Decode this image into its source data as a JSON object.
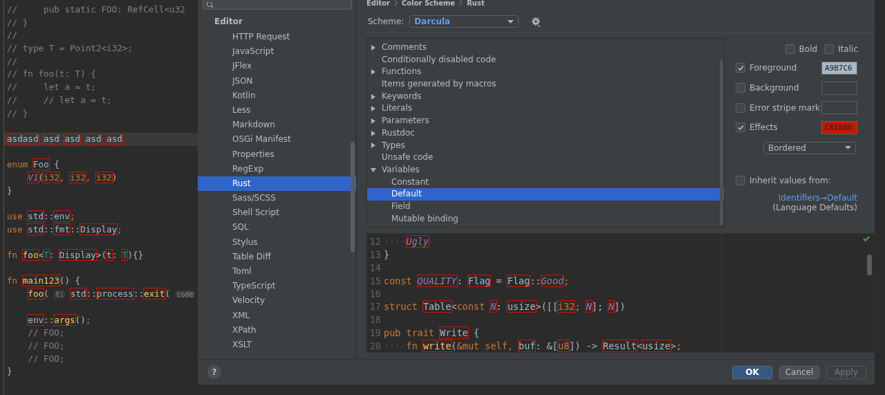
{
  "editor": {
    "lines": [
      {
        "current": false,
        "tokens": [
          {
            "kind": "comment",
            "text": "//     pub static FOO: RefCell<u32"
          }
        ]
      },
      {
        "current": false,
        "tokens": [
          {
            "kind": "comment",
            "text": "// }"
          }
        ]
      },
      {
        "current": false,
        "tokens": [
          {
            "kind": "comment",
            "text": "//"
          }
        ]
      },
      {
        "current": false,
        "tokens": [
          {
            "kind": "comment",
            "text": "// type T = Point2<i32>;"
          }
        ]
      },
      {
        "current": false,
        "tokens": [
          {
            "kind": "comment",
            "text": "//"
          }
        ]
      },
      {
        "current": false,
        "tokens": [
          {
            "kind": "comment",
            "text": "// fn foo(t: T) {"
          }
        ]
      },
      {
        "current": false,
        "tokens": [
          {
            "kind": "comment",
            "text": "//     let a = t;"
          }
        ]
      },
      {
        "current": false,
        "tokens": [
          {
            "kind": "comment",
            "text": "//     // let a = t;"
          }
        ]
      },
      {
        "current": false,
        "tokens": [
          {
            "kind": "comment",
            "text": "// }"
          }
        ]
      },
      {
        "current": false
      },
      {
        "current": true,
        "tokens": [
          {
            "kind": "ident",
            "text": "asdasd"
          },
          {
            "kind": "ident",
            "text": "asd",
            "space_before": true
          },
          {
            "kind": "ident",
            "text": "asd",
            "space_before": true
          },
          {
            "kind": "ident",
            "text": "asd",
            "space_before": true
          },
          {
            "kind": "ident",
            "text": "asd",
            "space_before": true
          }
        ]
      },
      {
        "current": false
      },
      {
        "current": false,
        "tokens": [
          {
            "kind": "kw",
            "text": "enum "
          },
          {
            "kind": "ident",
            "text": "Foo"
          },
          {
            "kind": "plain",
            "text": " {"
          }
        ]
      },
      {
        "current": false,
        "tokens": [
          {
            "kind": "const",
            "text": "V1",
            "indent": true
          },
          {
            "kind": "plain",
            "text": "("
          },
          {
            "kind": "builtin",
            "text": "i32"
          },
          {
            "kind": "kw",
            "text": ", "
          },
          {
            "kind": "builtin",
            "text": "i32"
          },
          {
            "kind": "kw",
            "text": ", "
          },
          {
            "kind": "builtin",
            "text": "i32"
          },
          {
            "kind": "plain",
            "text": ")"
          }
        ]
      },
      {
        "current": false,
        "tokens": [
          {
            "kind": "plain",
            "text": "}"
          }
        ]
      },
      {
        "current": false
      },
      {
        "current": false,
        "tokens": [
          {
            "kind": "kw",
            "text": "use "
          },
          {
            "kind": "ident",
            "text": "std"
          },
          {
            "kind": "plain",
            "text": "::"
          },
          {
            "kind": "ident",
            "text": "env"
          },
          {
            "kind": "kw",
            "text": ";"
          }
        ]
      },
      {
        "current": false,
        "tokens": [
          {
            "kind": "kw",
            "text": "use "
          },
          {
            "kind": "ident",
            "text": "std"
          },
          {
            "kind": "plain",
            "text": "::"
          },
          {
            "kind": "ident",
            "text": "fmt"
          },
          {
            "kind": "plain",
            "text": "::"
          },
          {
            "kind": "ident",
            "text": "Display"
          },
          {
            "kind": "kw",
            "text": ";"
          }
        ]
      },
      {
        "current": false
      },
      {
        "current": false,
        "tokens": [
          {
            "kind": "kw",
            "text": "fn "
          },
          {
            "kind": "fn",
            "text": "foo"
          },
          {
            "kind": "plain",
            "text": "<"
          },
          {
            "kind": "tparam",
            "text": "T"
          },
          {
            "kind": "plain",
            "text": ": "
          },
          {
            "kind": "ident",
            "text": "Display"
          },
          {
            "kind": "plain",
            "text": ">("
          },
          {
            "kind": "param",
            "text": "t"
          },
          {
            "kind": "plain",
            "text": ": "
          },
          {
            "kind": "tparam",
            "text": "T"
          },
          {
            "kind": "plain",
            "text": "){}"
          }
        ]
      },
      {
        "current": false
      },
      {
        "current": false,
        "tokens": [
          {
            "kind": "kw",
            "text": "fn "
          },
          {
            "kind": "fn",
            "text": "main123"
          },
          {
            "kind": "plain",
            "text": "() {"
          }
        ]
      },
      {
        "current": false,
        "tokens": [
          {
            "kind": "fn",
            "text": "foo",
            "indent": true
          },
          {
            "kind": "plain",
            "text": "( "
          },
          {
            "kind": "hint",
            "text": "t:"
          },
          {
            "kind": "ident",
            "text": "std",
            "space_before": true
          },
          {
            "kind": "plain",
            "text": "::"
          },
          {
            "kind": "ident",
            "text": "process"
          },
          {
            "kind": "plain",
            "text": "::"
          },
          {
            "kind": "fn",
            "text": "exit"
          },
          {
            "kind": "plain",
            "text": "( "
          },
          {
            "kind": "hint",
            "text": "code"
          }
        ]
      },
      {
        "current": false
      },
      {
        "current": false,
        "tokens": [
          {
            "kind": "ident",
            "text": "env",
            "indent": true
          },
          {
            "kind": "plain",
            "text": "::"
          },
          {
            "kind": "fn",
            "text": "args"
          },
          {
            "kind": "plain",
            "text": "()"
          },
          {
            "kind": "kw",
            "text": ";"
          }
        ]
      },
      {
        "current": false,
        "tokens": [
          {
            "kind": "comment",
            "text": "    // FOO;"
          }
        ]
      },
      {
        "current": false,
        "tokens": [
          {
            "kind": "comment",
            "text": "    // FOO;"
          }
        ]
      },
      {
        "current": false,
        "tokens": [
          {
            "kind": "comment",
            "text": "    // FOO;"
          }
        ]
      },
      {
        "current": false,
        "tokens": [
          {
            "kind": "plain",
            "text": "}"
          }
        ]
      }
    ]
  },
  "dialog": {
    "sidebar": {
      "section": "Editor",
      "items": [
        {
          "label": "HTTP Request",
          "selected": false
        },
        {
          "label": "JavaScript",
          "selected": false
        },
        {
          "label": "JFlex",
          "selected": false
        },
        {
          "label": "JSON",
          "selected": false
        },
        {
          "label": "Kotlin",
          "selected": false
        },
        {
          "label": "Less",
          "selected": false
        },
        {
          "label": "Markdown",
          "selected": false
        },
        {
          "label": "OSGi Manifest",
          "selected": false
        },
        {
          "label": "Properties",
          "selected": false
        },
        {
          "label": "RegExp",
          "selected": false
        },
        {
          "label": "Rust",
          "selected": true
        },
        {
          "label": "Sass/SCSS",
          "selected": false
        },
        {
          "label": "Shell Script",
          "selected": false
        },
        {
          "label": "SQL",
          "selected": false
        },
        {
          "label": "Stylus",
          "selected": false
        },
        {
          "label": "Table Diff",
          "selected": false
        },
        {
          "label": "Toml",
          "selected": false
        },
        {
          "label": "TypeScript",
          "selected": false
        },
        {
          "label": "Velocity",
          "selected": false
        },
        {
          "label": "XML",
          "selected": false
        },
        {
          "label": "XPath",
          "selected": false
        },
        {
          "label": "XSLT",
          "selected": false
        }
      ]
    },
    "breadcrumb": [
      "Editor",
      "Color Scheme",
      "Rust"
    ],
    "scheme": {
      "label": "Scheme:",
      "value": "Darcula"
    },
    "tree": [
      {
        "label": "Comments",
        "kind": "group",
        "expanded": false,
        "selected": false
      },
      {
        "label": "Conditionally disabled code",
        "kind": "leaf",
        "selected": false
      },
      {
        "label": "Functions",
        "kind": "group",
        "expanded": false,
        "selected": false
      },
      {
        "label": "Items generated by macros",
        "kind": "leaf",
        "selected": false
      },
      {
        "label": "Keywords",
        "kind": "group",
        "expanded": false,
        "selected": false
      },
      {
        "label": "Literals",
        "kind": "group",
        "expanded": false,
        "selected": false
      },
      {
        "label": "Parameters",
        "kind": "group",
        "expanded": false,
        "selected": false
      },
      {
        "label": "Rustdoc",
        "kind": "group",
        "expanded": false,
        "selected": false
      },
      {
        "label": "Types",
        "kind": "group",
        "expanded": false,
        "selected": false
      },
      {
        "label": "Unsafe code",
        "kind": "leaf",
        "selected": false
      },
      {
        "label": "Variables",
        "kind": "group",
        "expanded": true,
        "selected": false,
        "children": [
          {
            "label": "Constant",
            "kind": "leaf",
            "selected": false
          },
          {
            "label": "Default",
            "kind": "leaf",
            "selected": true
          },
          {
            "label": "Field",
            "kind": "leaf",
            "selected": false
          },
          {
            "label": "Mutable binding",
            "kind": "leaf",
            "selected": false
          }
        ]
      }
    ],
    "font_style": [
      {
        "label": "Bold",
        "checked": false
      },
      {
        "label": "Italic",
        "checked": false
      }
    ],
    "attributes": [
      {
        "label": "Foreground",
        "checked": true,
        "value": "A9B7C6",
        "color": "#a9b7c6"
      },
      {
        "label": "Background",
        "checked": false
      },
      {
        "label": "Error stripe mark",
        "checked": false
      },
      {
        "label": "Effects",
        "checked": true,
        "value": "C61800",
        "color": "#c61800"
      }
    ],
    "effect_type": "Bordered",
    "inherit": {
      "label": "Inherit values from:",
      "checked": false,
      "link": "Identifiers→Default",
      "note": "(Language Defaults)"
    },
    "preview": [
      {
        "number": "12",
        "tokens": [
          {
            "kind": "ws",
            "text": "····"
          },
          {
            "kind": "const",
            "text": "Ugly"
          }
        ]
      },
      {
        "number": "13",
        "tokens": [
          {
            "kind": "plain",
            "text": "}"
          }
        ]
      },
      {
        "number": "14"
      },
      {
        "number": "15",
        "tokens": [
          {
            "kind": "kw",
            "text": "const "
          },
          {
            "kind": "const",
            "text": "QUALITY"
          },
          {
            "kind": "plain",
            "text": ": "
          },
          {
            "kind": "ident",
            "text": "Flag"
          },
          {
            "kind": "plain",
            "text": " = "
          },
          {
            "kind": "ident",
            "text": "Flag"
          },
          {
            "kind": "plain",
            "text": "::"
          },
          {
            "kind": "const",
            "text": "Good"
          },
          {
            "kind": "kw",
            "text": ";"
          }
        ]
      },
      {
        "number": "16"
      },
      {
        "number": "17",
        "tokens": [
          {
            "kind": "kw",
            "text": "struct "
          },
          {
            "kind": "ident",
            "text": "Table"
          },
          {
            "kind": "plain",
            "text": "<"
          },
          {
            "kind": "kw",
            "text": "const "
          },
          {
            "kind": "const",
            "text": "N"
          },
          {
            "kind": "plain",
            "text": ": "
          },
          {
            "kind": "ident",
            "text": "usize"
          },
          {
            "kind": "plain",
            "text": ">([["
          },
          {
            "kind": "builtin",
            "text": "i32"
          },
          {
            "kind": "kw",
            "text": "; "
          },
          {
            "kind": "const",
            "text": "N"
          },
          {
            "kind": "plain",
            "text": "]; "
          },
          {
            "kind": "const",
            "text": "N"
          },
          {
            "kind": "plain",
            "text": "])"
          }
        ]
      },
      {
        "number": "18"
      },
      {
        "number": "19",
        "tokens": [
          {
            "kind": "kw",
            "text": "pub trait "
          },
          {
            "kind": "ident",
            "text": "Write"
          },
          {
            "kind": "plain",
            "text": " {"
          }
        ]
      },
      {
        "number": "20",
        "tokens": [
          {
            "kind": "ws",
            "text": "····"
          },
          {
            "kind": "kw",
            "text": "fn "
          },
          {
            "kind": "fn",
            "text": "write"
          },
          {
            "kind": "plain",
            "text": "("
          },
          {
            "kind": "kw",
            "text": "&mut self, "
          },
          {
            "kind": "ident",
            "text": "buf"
          },
          {
            "kind": "plain",
            "text": ": &["
          },
          {
            "kind": "builtin",
            "text": "u8"
          },
          {
            "kind": "plain",
            "text": "]) -> "
          },
          {
            "kind": "ident",
            "text": "Result"
          },
          {
            "kind": "plain",
            "text": "<"
          },
          {
            "kind": "ident",
            "text": "usize"
          },
          {
            "kind": "plain",
            "text": ">"
          },
          {
            "kind": "kw",
            "text": ";"
          }
        ]
      }
    ],
    "help": "?",
    "buttons": [
      {
        "label": "OK",
        "kind": "primary",
        "disabled": false
      },
      {
        "label": "Cancel",
        "kind": "secondary",
        "disabled": false
      },
      {
        "label": "Apply",
        "kind": "secondary",
        "disabled": true
      }
    ]
  }
}
